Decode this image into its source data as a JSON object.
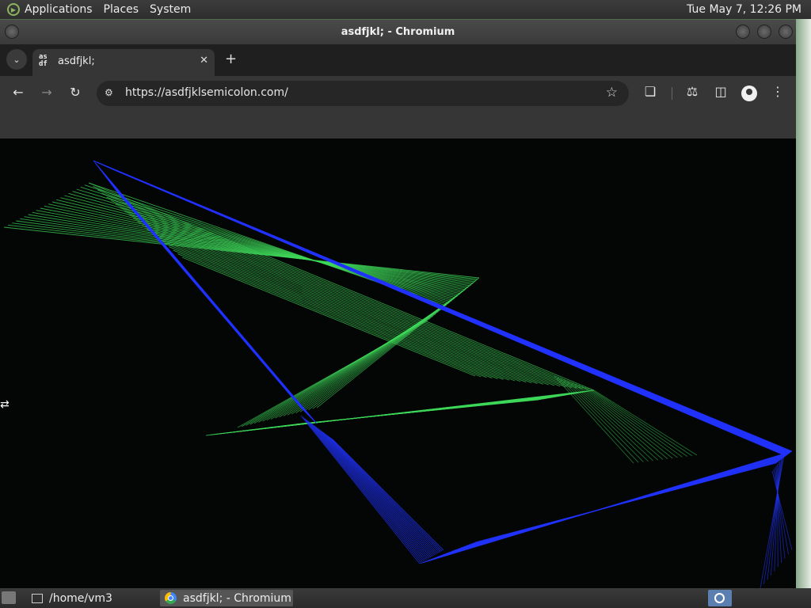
{
  "top_panel": {
    "menus": [
      "Applications",
      "Places",
      "System"
    ],
    "clock": "Tue May  7, 12:26 PM"
  },
  "window": {
    "title": "asdfjkl; - Chromium"
  },
  "browser": {
    "tab": {
      "favicon_text": "as\ndf",
      "title": "asdfjkl;"
    },
    "url": "https://asdfjklsemicolon.com/"
  },
  "icons": {
    "tab_search": "chevron-down-icon",
    "close": "close-icon",
    "new_tab": "plus-icon",
    "back": "arrow-left-icon",
    "forward": "arrow-right-icon",
    "reload": "reload-icon",
    "site_info": "tune-icon",
    "bookmark": "star-icon",
    "extensions": "puzzle-icon",
    "labs": "flask-icon",
    "side_panel": "side-panel-icon",
    "profile": "profile-icon",
    "menu": "kebab-icon"
  },
  "colors": {
    "green_lines": "#3fd85a",
    "blue_lines": "#2233ff",
    "content_bg": "#030605"
  },
  "taskbar": {
    "items": [
      {
        "label": "/home/vm3"
      },
      {
        "label": "asdfjkl; - Chromium"
      }
    ]
  }
}
